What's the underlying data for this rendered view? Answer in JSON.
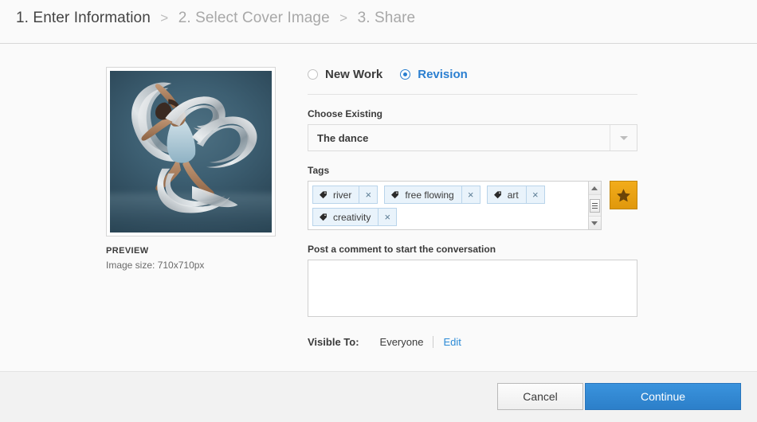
{
  "breadcrumb": {
    "steps": [
      {
        "label": "1. Enter Information",
        "active": true
      },
      {
        "label": "2. Select Cover Image",
        "active": false
      },
      {
        "label": "3. Share",
        "active": false
      }
    ],
    "separator": ">"
  },
  "preview": {
    "caption": "PREVIEW",
    "size_text": "Image size: 710x710px",
    "alt": "Dancer wrapped in flowing silver ribbons on a teal background"
  },
  "form": {
    "work_type": {
      "new_work_label": "New Work",
      "revision_label": "Revision",
      "selected": "Revision"
    },
    "choose_existing": {
      "label": "Choose Existing",
      "value": "The dance"
    },
    "tags": {
      "label": "Tags",
      "items": [
        {
          "text": "river",
          "remove": "×"
        },
        {
          "text": "free flowing",
          "remove": "×"
        },
        {
          "text": "art",
          "remove": "×"
        },
        {
          "text": "creativity",
          "remove": "×"
        }
      ],
      "featured_button": "star"
    },
    "comment": {
      "label": "Post a comment to start the conversation",
      "value": "",
      "placeholder": ""
    },
    "visibility": {
      "label": "Visible To:",
      "value": "Everyone",
      "edit_label": "Edit"
    }
  },
  "footer": {
    "cancel_label": "Cancel",
    "continue_label": "Continue"
  },
  "colors": {
    "accent_blue": "#2b7fd0",
    "link_blue": "#2b8ad6",
    "star_gold": "#e8a312",
    "page_bg": "#fafafa",
    "footer_bg": "#f2f2f2",
    "chip_bg": "#e9f3fb"
  }
}
